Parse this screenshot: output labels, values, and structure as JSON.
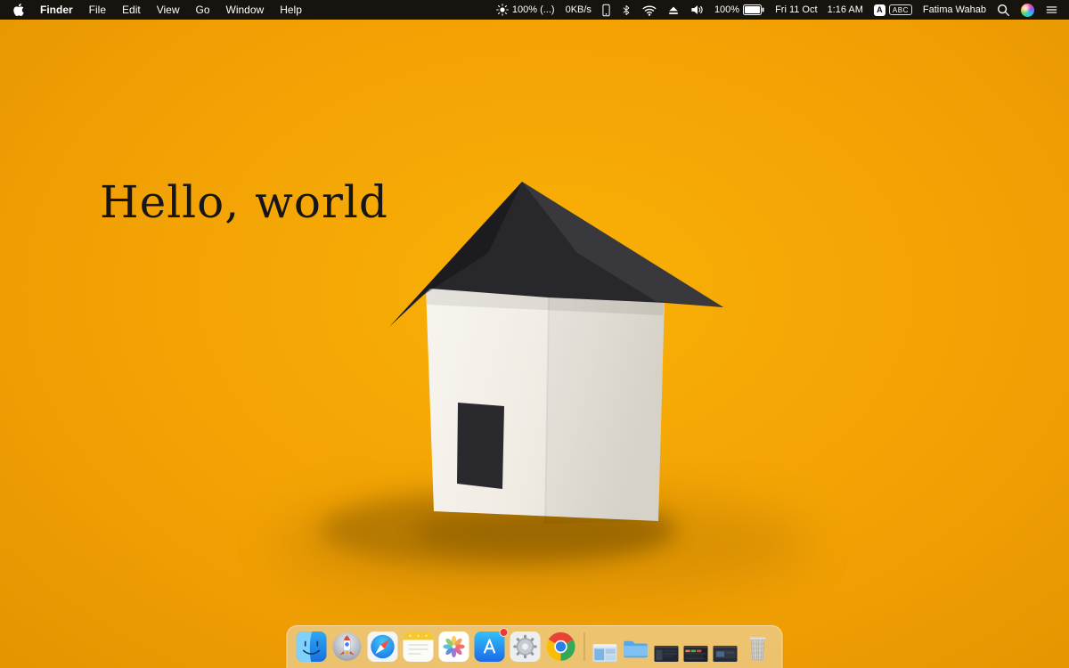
{
  "menu_bar": {
    "app_name": "Finder",
    "menus": [
      "File",
      "Edit",
      "View",
      "Go",
      "Window",
      "Help"
    ],
    "status": {
      "brightness_label": "100% (...)",
      "network_speed": "0KB/s",
      "battery_percent": "100%",
      "date": "Fri 11 Oct",
      "time": "1:16 AM",
      "input_key": "A",
      "input_source": "ABC",
      "user_name": "Fatima Wahab"
    },
    "status_icons": [
      "brightness-icon",
      "device-icon",
      "bluetooth-icon",
      "wifi-icon",
      "eject-icon",
      "volume-icon",
      "battery-icon",
      "spotlight-icon",
      "siri-icon",
      "notification-center-icon"
    ]
  },
  "desktop": {
    "wallpaper_text": "Hello, world"
  },
  "dock": {
    "items": [
      "finder",
      "launchpad",
      "safari",
      "notes",
      "photos",
      "app-store",
      "system-preferences",
      "chrome",
      "minimized-window",
      "downloads-folder",
      "minimized-window",
      "minimized-window",
      "minimized-window",
      "trash"
    ],
    "app_store_badge": true
  },
  "colors": {
    "desktop_background": "#F2A104",
    "menu_bar_background": "#101010",
    "roof": "#28282C",
    "house_face": "#F4F1EA",
    "badge": "#EC3B2F"
  }
}
